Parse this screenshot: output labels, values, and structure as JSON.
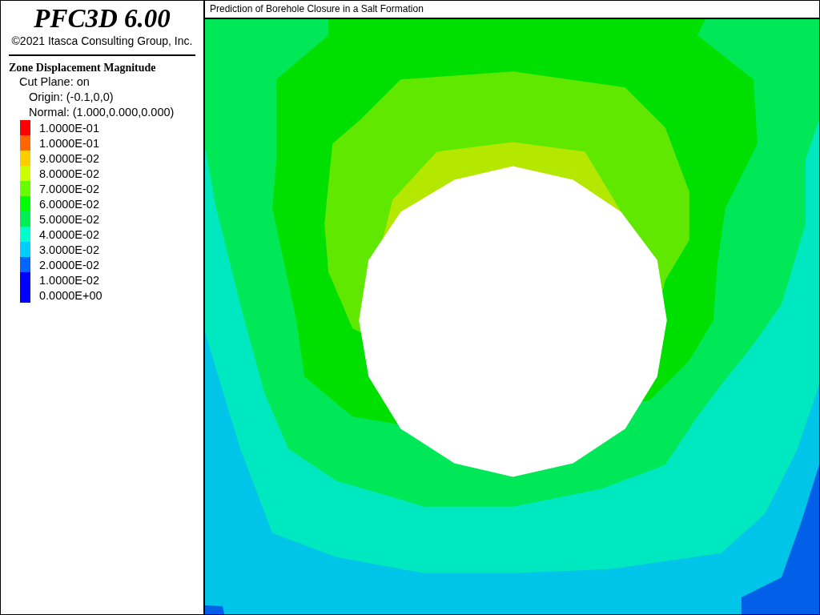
{
  "header": {
    "product": "PFC3D 6.00",
    "copyright": "©2021 Itasca Consulting Group, Inc."
  },
  "legend": {
    "title": "Zone Displacement Magnitude",
    "cut_plane": "Cut Plane: on",
    "origin": "Origin: (-0.1,0,0)",
    "normal": "Normal: (1.000,0.000,0.000)",
    "entries": [
      {
        "label": "1.0000E-01",
        "color": "#ff0000"
      },
      {
        "label": "1.0000E-01",
        "color": "#ff6600"
      },
      {
        "label": "9.0000E-02",
        "color": "#ffcc00"
      },
      {
        "label": "8.0000E-02",
        "color": "#ccff00"
      },
      {
        "label": "7.0000E-02",
        "color": "#66ff00"
      },
      {
        "label": "6.0000E-02",
        "color": "#00ff00"
      },
      {
        "label": "5.0000E-02",
        "color": "#00ee55"
      },
      {
        "label": "4.0000E-02",
        "color": "#00ffcc"
      },
      {
        "label": "3.0000E-02",
        "color": "#00ccff"
      },
      {
        "label": "2.0000E-02",
        "color": "#0066ff"
      },
      {
        "label": "1.0000E-02",
        "color": "#0000ff"
      },
      {
        "label": "0.0000E+00",
        "color": "#0000ff"
      }
    ]
  },
  "plot": {
    "title": "Prediction of Borehole Closure in a Salt Formation"
  }
}
